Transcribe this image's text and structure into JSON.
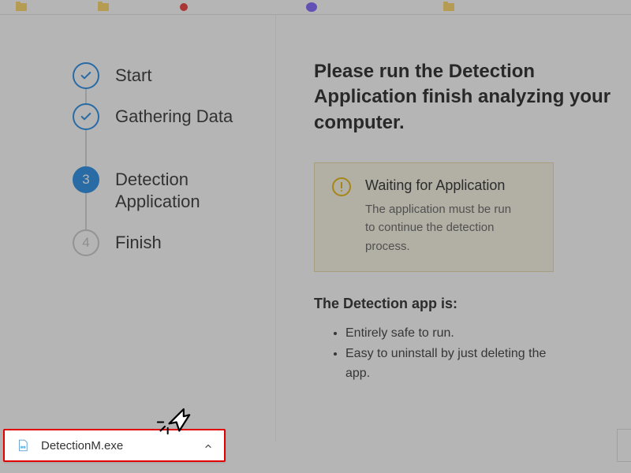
{
  "steps": [
    {
      "label": "Start",
      "state": "done"
    },
    {
      "label": "Gathering Data",
      "state": "done"
    },
    {
      "label": "Detection Application",
      "state": "current",
      "num": "3"
    },
    {
      "label": "Finish",
      "state": "pending",
      "num": "4"
    }
  ],
  "heading": "Please run the Detection Application finish analyzing your computer.",
  "alert": {
    "title": "Waiting for Application",
    "body": "The application must be run to continue the detection process."
  },
  "listHeading": "The Detection app is:",
  "bullets": [
    "Entirely safe to run.",
    "Easy to uninstall by just deleting the app."
  ],
  "download": {
    "filename": "DetectionM.exe"
  }
}
